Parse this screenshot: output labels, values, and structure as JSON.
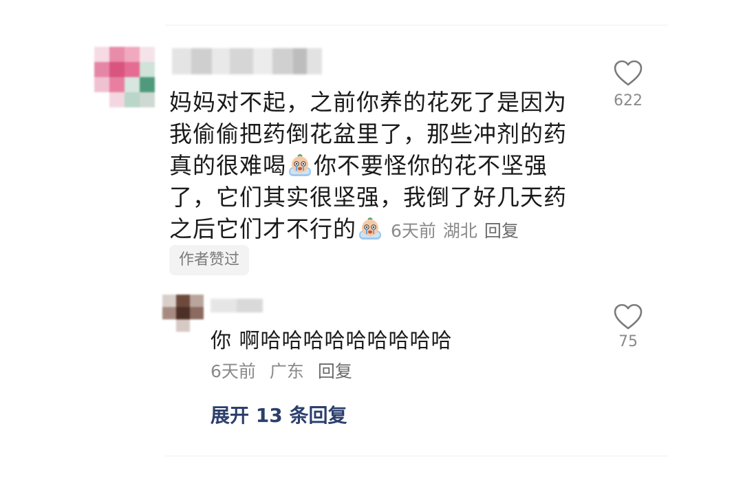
{
  "comment": {
    "text_part1": "妈妈对不起，之前你养的花死了是因为我偷偷把药倒花盆里了，那些冲剂的药真的很难喝",
    "text_part2": "你不要怪你的花不坚强了，它们其实很坚强，我倒了好几天药之后它们才不行的",
    "emoji_name": "crying-face-emoji",
    "time": "6天前",
    "location": "湖北",
    "reply_label": "回复",
    "author_liked_badge": "作者赞过",
    "like_count": "622",
    "like_icon": "heart-outline-icon"
  },
  "reply": {
    "text": "你 啊哈哈哈哈哈哈哈哈哈",
    "time": "6天前",
    "location": "广东",
    "reply_label": "回复",
    "like_count": "75",
    "like_icon": "heart-outline-icon"
  },
  "expand_replies_label": "展开 13 条回复",
  "colors": {
    "text": "#1a1a1a",
    "meta": "#8a8a8a",
    "link": "#2b3f6c",
    "badge_bg": "#f3f3f3"
  }
}
